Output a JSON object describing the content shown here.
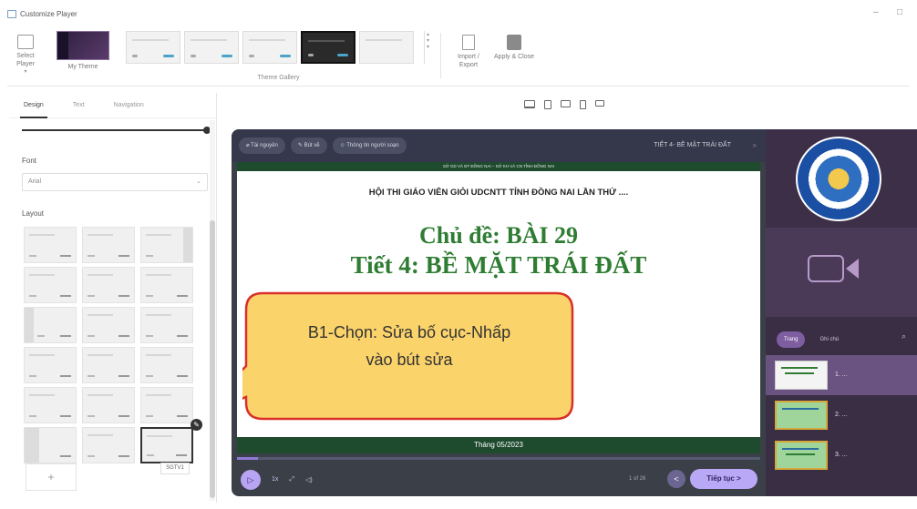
{
  "window": {
    "title": "Customize Player",
    "minimize": "–",
    "maximize": "□"
  },
  "ribbon": {
    "select_player": "Select Player",
    "my_theme": "My Theme",
    "gallery_label": "Theme Gallery",
    "import_export": "Import / Export",
    "apply_close": "Apply & Close"
  },
  "left_panel": {
    "tabs": [
      "Design",
      "Text",
      "Navigation"
    ],
    "font_label": "Font",
    "font_value": "Arial",
    "layout_label": "Layout",
    "add_label": "+",
    "tooltip": "SGTV1"
  },
  "player": {
    "chips": [
      "Tài nguyên",
      "Bút vẽ",
      "Thông tin người soạn"
    ],
    "header_title": "TIẾT 4- BỀ MẶT TRÁI ĐẤT",
    "slide": {
      "band": "SỞ GD VÀ ĐT ĐỒNG NAI – SỞ KH VÀ CN TỈNH ĐỒNG NAI",
      "heading": "HỘI THI GIÁO VIÊN GIỎI UDCNTT TỈNH ĐỒNG NAI LẦN THỨ ....",
      "topic": "Chủ đề: BÀI 29",
      "lesson": "Tiết 4: BỀ MẶT TRÁI ĐẤT",
      "footer": "Tháng 05/2023"
    },
    "progress": 0.04,
    "controls": {
      "play": "▷",
      "speed": "1x",
      "fullscreen": "⤢",
      "volume": "◁)"
    },
    "page_info": "1 of 26",
    "prev": "<",
    "next": "Tiếp tục >"
  },
  "sidebar": {
    "tabs": [
      "Trang",
      "Ghi chú"
    ],
    "thumbs": [
      "1. ...",
      "2. ...",
      "3. ..."
    ]
  },
  "callout": {
    "line1": "B1-Chọn: Sửa bố cục-Nhấp",
    "line2": "vào bút sửa",
    "fill": "#fbd36b",
    "border": "#d9302a"
  }
}
